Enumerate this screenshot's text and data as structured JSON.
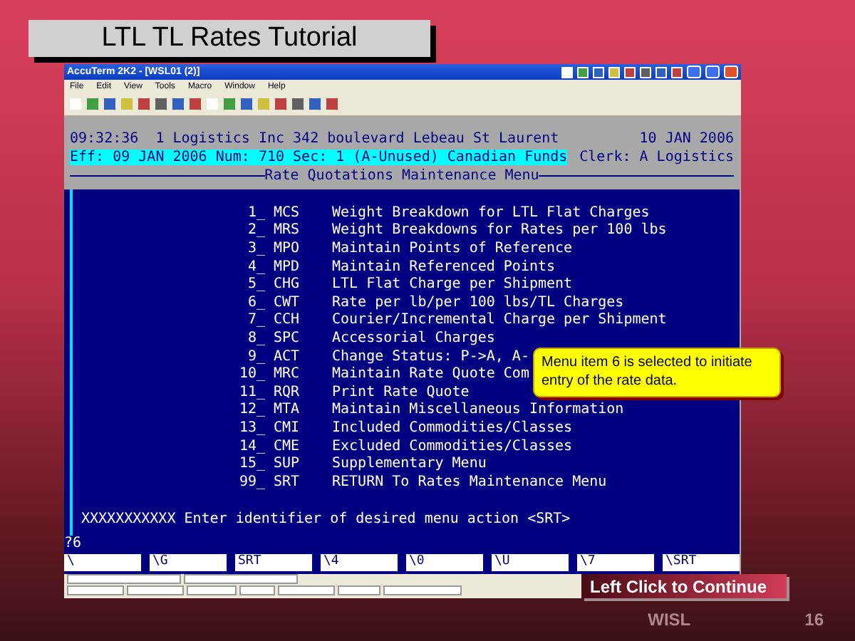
{
  "slide_title": "LTL TL Rates Tutorial",
  "window": {
    "title": "AccuTerm 2K2 - [WSL01 (2)]",
    "menu": [
      "File",
      "Edit",
      "View",
      "Tools",
      "Macro",
      "Window",
      "Help"
    ]
  },
  "terminal": {
    "header": {
      "time": "09:32:36",
      "company": "1 Logistics Inc 342 boulevard Lebeau St Laurent",
      "date": "10 JAN 2006",
      "status": "Eff: 09 JAN 2006 Num: 710 Sec: 1 (A-Unused) Canadian Funds",
      "clerk": "Clerk: A Logistics",
      "menu_title": "Rate Quotations Maintenance Menu"
    },
    "items": [
      {
        "number": "1_",
        "code": "MCS",
        "label": "Weight Breakdown for LTL Flat Charges"
      },
      {
        "number": "2_",
        "code": "MRS",
        "label": "Weight Breakdowns for Rates per 100 lbs"
      },
      {
        "number": "3_",
        "code": "MPO",
        "label": "Maintain Points of Reference"
      },
      {
        "number": "4_",
        "code": "MPD",
        "label": "Maintain Referenced Points"
      },
      {
        "number": "5_",
        "code": "CHG",
        "label": "LTL Flat Charge per Shipment"
      },
      {
        "number": "6_",
        "code": "CWT",
        "label": "Rate per lb/per 100 lbs/TL Charges"
      },
      {
        "number": "7_",
        "code": "CCH",
        "label": "Courier/Incremental Charge per Shipment"
      },
      {
        "number": "8_",
        "code": "SPC",
        "label": "Accessorial Charges"
      },
      {
        "number": "9_",
        "code": "ACT",
        "label": "Change Status: P->A, A-"
      },
      {
        "number": "10_",
        "code": "MRC",
        "label": "Maintain Rate Quote Com"
      },
      {
        "number": "11_",
        "code": "RQR",
        "label": "Print Rate Quote"
      },
      {
        "number": "12_",
        "code": "MTA",
        "label": "Maintain Miscellaneous Information"
      },
      {
        "number": "13_",
        "code": "CMI",
        "label": "Included Commodities/Classes"
      },
      {
        "number": "14_",
        "code": "CME",
        "label": "Excluded Commodities/Classes"
      },
      {
        "number": "15_",
        "code": "SUP",
        "label": "Supplementary Menu"
      },
      {
        "number": "99_",
        "code": "SRT",
        "label": "RETURN To Rates Maintenance Menu"
      }
    ],
    "prompt": "XXXXXXXXXXX Enter identifier of desired menu action <SRT>",
    "input": "?6",
    "function_keys": [
      {
        "label": "\\"
      },
      {
        "label": "\\G"
      },
      {
        "label": "SRT"
      },
      {
        "label": "\\4"
      },
      {
        "label": "\\0"
      },
      {
        "label": "\\U"
      },
      {
        "label": "\\7"
      },
      {
        "label": "\\SRT"
      }
    ]
  },
  "callout": "Menu item 6 is selected to initiate entry of the rate data.",
  "continue_button": "Left Click to Continue",
  "footer": {
    "org": "WISL",
    "page": "16"
  }
}
